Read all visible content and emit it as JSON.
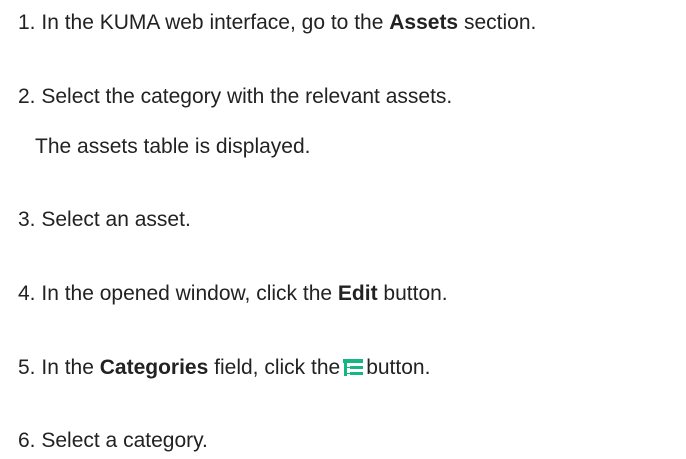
{
  "steps": [
    {
      "number": "1.",
      "before": "In the KUMA web interface, go to the",
      "bold": "Assets",
      "after": "section."
    },
    {
      "number": "2.",
      "text": "Select the category with the relevant assets.",
      "result": "The assets table is displayed."
    },
    {
      "number": "3.",
      "text": "Select an asset."
    },
    {
      "number": "4.",
      "before": "In the opened window, click the",
      "bold": "Edit",
      "after": "button."
    },
    {
      "number": "5.",
      "before": "In the",
      "bold": "Categories",
      "middle": "field, click the",
      "icon": "category-tree-icon",
      "after": "button."
    },
    {
      "number": "6.",
      "text": "Select a category."
    }
  ],
  "colors": {
    "text": "#222222",
    "icon_accent": "#16b584"
  }
}
